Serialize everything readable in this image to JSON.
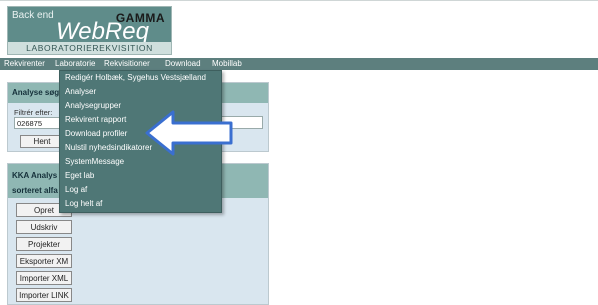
{
  "logo": {
    "backend": "Back end",
    "brand": "GAMMA",
    "title": "WebReq",
    "subtitle": "LABORATORIEREKVISITION"
  },
  "menu": [
    {
      "label": "Rekvirenter"
    },
    {
      "label": "Laboratorie"
    },
    {
      "label": "Rekvisitioner"
    },
    {
      "label": "Download"
    },
    {
      "label": "Mobillab"
    }
  ],
  "dropdown": [
    "Redigér Holbæk, Sygehus Vestsjælland",
    "Analyser",
    "Analysegrupper",
    "Rekvirent rapport",
    "Download profiler",
    "Nulstil nyhedsindikatorer",
    "SystemMessage",
    "Eget lab",
    "Log af",
    "Log helt af"
  ],
  "search_panel": {
    "title": "Analyse søg",
    "filter_label": "Filtrér efter:",
    "filter_value": "026875",
    "button": "Hent"
  },
  "kka_panel": {
    "title_line1": "KKA Analys",
    "title_line2": "sorteret alfa",
    "buttons": [
      "Opret",
      "Udskriv",
      "Projekter",
      "Eksporter XM",
      "Importer XML",
      "Importer LINK"
    ]
  },
  "colors": {
    "menubar": "#5d7f7e",
    "dropdown": "#4f7776",
    "panel_head": "#8fb7b3",
    "panel_body": "#d9e6ef",
    "arrow": "#3a6fd0"
  }
}
